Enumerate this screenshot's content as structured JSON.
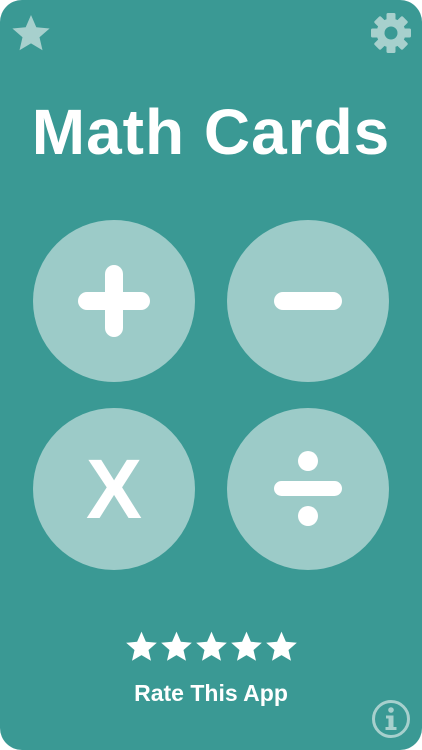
{
  "app": {
    "title": "Math Cards"
  },
  "colors": {
    "background": "#3a9994",
    "circle": "#9ccbc8",
    "top_icon": "#a7d0cd",
    "foreground": "#ffffff"
  },
  "top_bar": {
    "favorite_icon": "star-icon",
    "settings_icon": "gear-icon"
  },
  "operations": [
    {
      "label": "+",
      "icon": "plus-icon"
    },
    {
      "label": "−",
      "icon": "minus-icon"
    },
    {
      "label": "X",
      "icon": "multiply-icon"
    },
    {
      "label": "÷",
      "icon": "divide-icon"
    }
  ],
  "rating": {
    "stars": 5,
    "label": "Rate This App"
  },
  "footer": {
    "info_icon": "info-icon"
  }
}
